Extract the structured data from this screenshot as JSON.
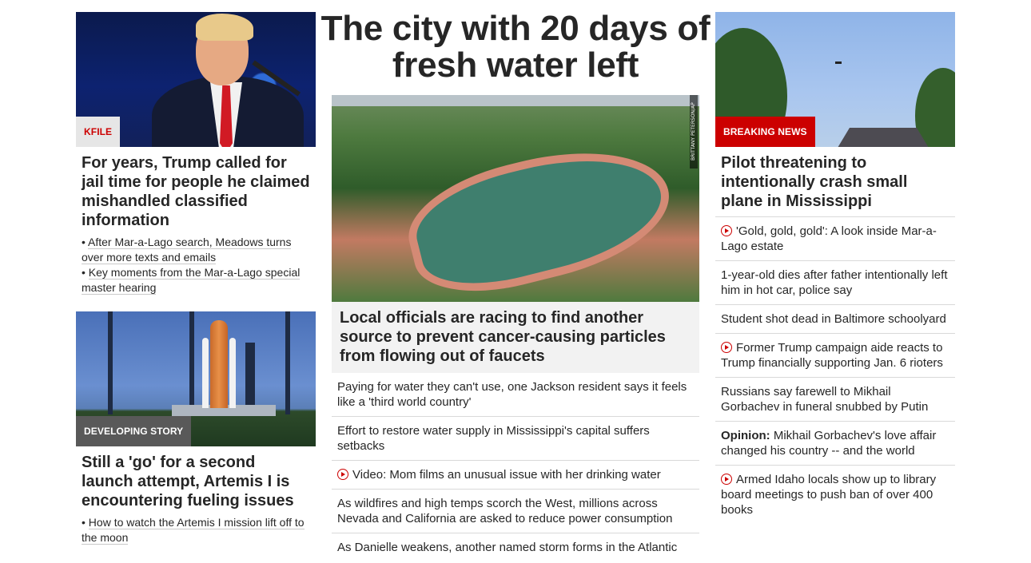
{
  "left": {
    "story1": {
      "label": "KFILE",
      "headline": "For years, Trump called for jail time for people he claimed mishandled classified information",
      "bullets": [
        "After Mar-a-Lago search, Meadows turns over more texts and emails",
        "Key moments from the Mar-a-Lago special master hearing"
      ]
    },
    "story2": {
      "label": "DEVELOPING STORY",
      "headline": "Still a 'go' for a second launch attempt, Artemis I is encountering fueling issues",
      "bullets": [
        "How to watch the Artemis I mission lift off to the moon"
      ]
    }
  },
  "middle": {
    "title": "The city with 20 days of fresh water left",
    "photo_credit": "BRITTANY PETERSON/AP",
    "caption": "Local officials are racing to find another source to prevent cancer-causing particles from flowing out of faucets",
    "links": [
      {
        "text": "Paying for water they can't use, one Jackson resident says it feels like a 'third world country'",
        "video": false
      },
      {
        "text": "Effort to restore water supply in Mississippi's capital suffers setbacks",
        "video": false
      },
      {
        "text": "Video: Mom films an unusual issue with her drinking water",
        "video": true
      },
      {
        "text": "As wildfires and high temps scorch the West, millions across Nevada and California are asked to reduce power consumption",
        "video": false
      },
      {
        "text": "As Danielle weakens, another named storm forms in the Atlantic",
        "video": false
      }
    ]
  },
  "right": {
    "label": "BREAKING NEWS",
    "headline": "Pilot threatening to intentionally crash small plane in Mississippi",
    "links": [
      {
        "text": "'Gold, gold, gold': A look inside Mar-a-Lago estate",
        "video": true,
        "prefix": ""
      },
      {
        "text": "1-year-old dies after father intentionally left him in hot car, police say",
        "video": false,
        "prefix": ""
      },
      {
        "text": "Student shot dead in Baltimore schoolyard",
        "video": false,
        "prefix": ""
      },
      {
        "text": "Former Trump campaign aide reacts to Trump financially supporting Jan. 6 rioters",
        "video": true,
        "prefix": ""
      },
      {
        "text": "Russians say farewell to Mikhail Gorbachev in funeral snubbed by Putin",
        "video": false,
        "prefix": ""
      },
      {
        "text": "Mikhail Gorbachev's love affair changed his country -- and the world",
        "video": false,
        "prefix": "Opinion:"
      },
      {
        "text": "Armed Idaho locals show up to library board meetings to push ban of over 400 books",
        "video": true,
        "prefix": ""
      }
    ]
  },
  "colors": {
    "accent_red": "#cc0000",
    "label_gray": "#595959",
    "text": "#262626"
  }
}
